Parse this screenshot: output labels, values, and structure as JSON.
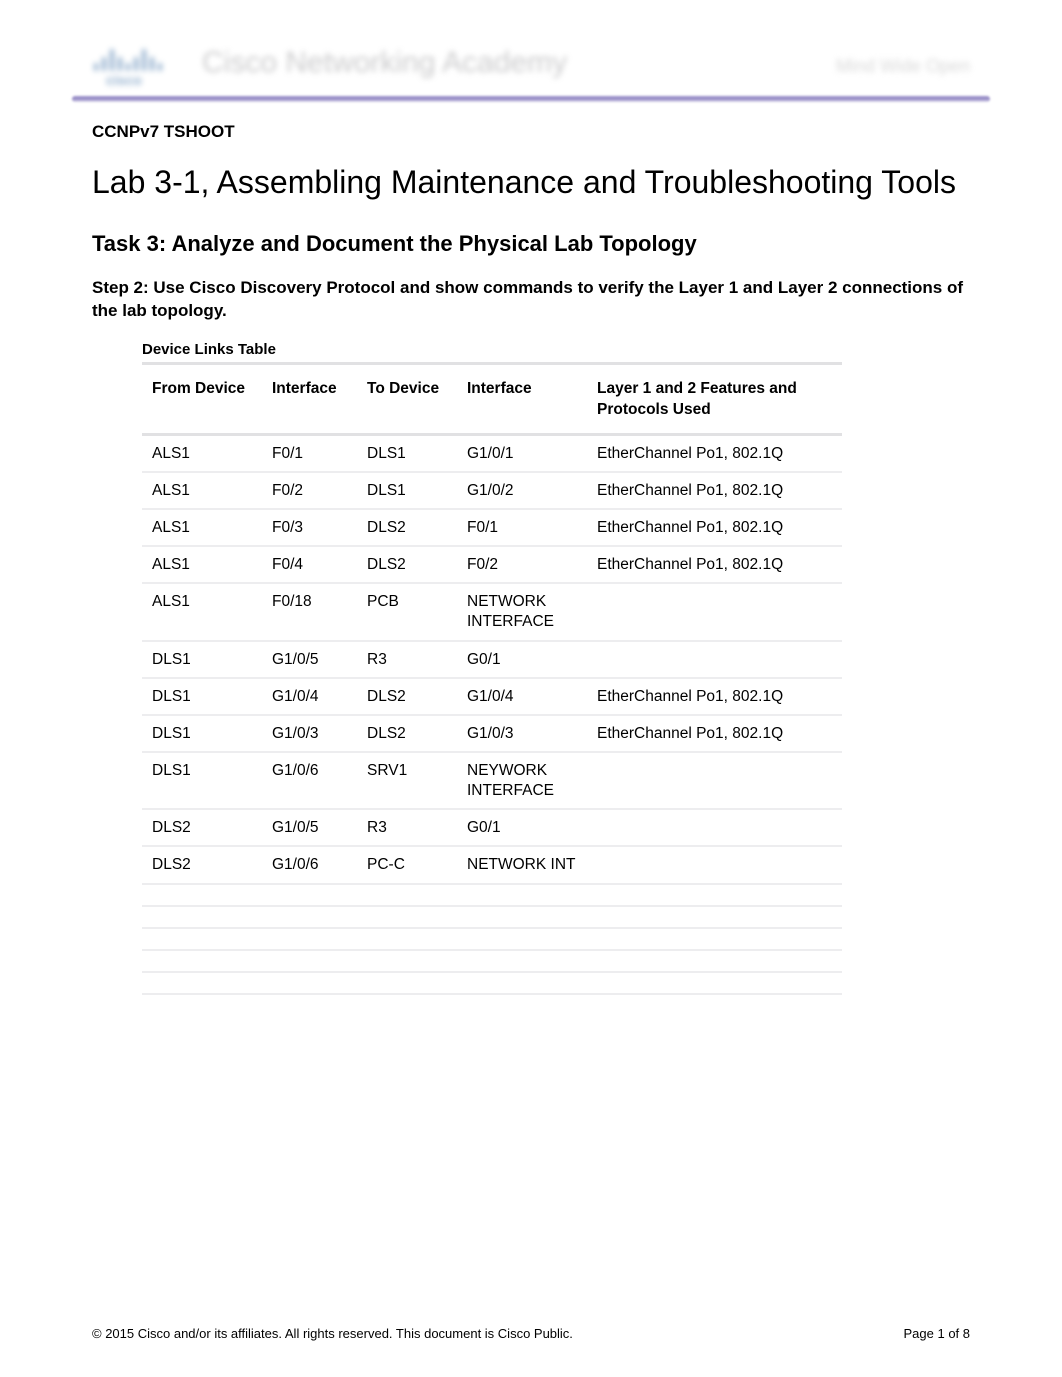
{
  "header": {
    "brand": "cisco",
    "academy": "Cisco Networking Academy",
    "tagline": "Mind Wide Open"
  },
  "course_code": "CCNPv7 TSHOOT",
  "lab_title": "Lab 3-1, Assembling Maintenance and Troubleshooting Tools",
  "task_title": "Task 3: Analyze and Document the Physical Lab Topology",
  "step_text": "Step 2: Use Cisco Discovery Protocol and show commands to verify the Layer 1 and Layer 2 connections of the lab topology.",
  "table_title": "Device Links Table",
  "table": {
    "headers": {
      "from_device": "From Device",
      "interface1": "Interface",
      "to_device": "To Device",
      "interface2": "Interface",
      "features": "Layer 1 and 2 Features and Protocols Used"
    },
    "rows": [
      {
        "from": "ALS1",
        "if1": "F0/1",
        "to": "DLS1",
        "if2": "G1/0/1",
        "feat": "EtherChannel Po1, 802.1Q"
      },
      {
        "from": "ALS1",
        "if1": "F0/2",
        "to": "DLS1",
        "if2": "G1/0/2",
        "feat": "EtherChannel Po1, 802.1Q"
      },
      {
        "from": "ALS1",
        "if1": "F0/3",
        "to": "DLS2",
        "if2": "F0/1",
        "feat": "EtherChannel Po1, 802.1Q"
      },
      {
        "from": "ALS1",
        "if1": "F0/4",
        "to": "DLS2",
        "if2": "F0/2",
        "feat": "EtherChannel Po1, 802.1Q"
      },
      {
        "from": "ALS1",
        "if1": "F0/18",
        "to": "PCB",
        "if2": "NETWORK INTERFACE",
        "feat": ""
      },
      {
        "from": "DLS1",
        "if1": "G1/0/5",
        "to": "R3",
        "if2": "G0/1",
        "feat": ""
      },
      {
        "from": "DLS1",
        "if1": "G1/0/4",
        "to": "DLS2",
        "if2": "G1/0/4",
        "feat": "EtherChannel Po1, 802.1Q"
      },
      {
        "from": "DLS1",
        "if1": "G1/0/3",
        "to": "DLS2",
        "if2": "G1/0/3",
        "feat": "EtherChannel Po1, 802.1Q"
      },
      {
        "from": "DLS1",
        "if1": "G1/0/6",
        "to": "SRV1",
        "if2": "NEYWORK INTERFACE",
        "feat": ""
      },
      {
        "from": "DLS2",
        "if1": "G1/0/5",
        "to": "R3",
        "if2": "G0/1",
        "feat": ""
      },
      {
        "from": "DLS2",
        "if1": "G1/0/6",
        "to": "PC-C",
        "if2": "NETWORK INT",
        "feat": ""
      }
    ],
    "empty_rows": 5
  },
  "footer": {
    "copyright": "© 2015 Cisco and/or its affiliates. All rights reserved. This document is Cisco Public.",
    "page": "Page 1 of 8"
  }
}
